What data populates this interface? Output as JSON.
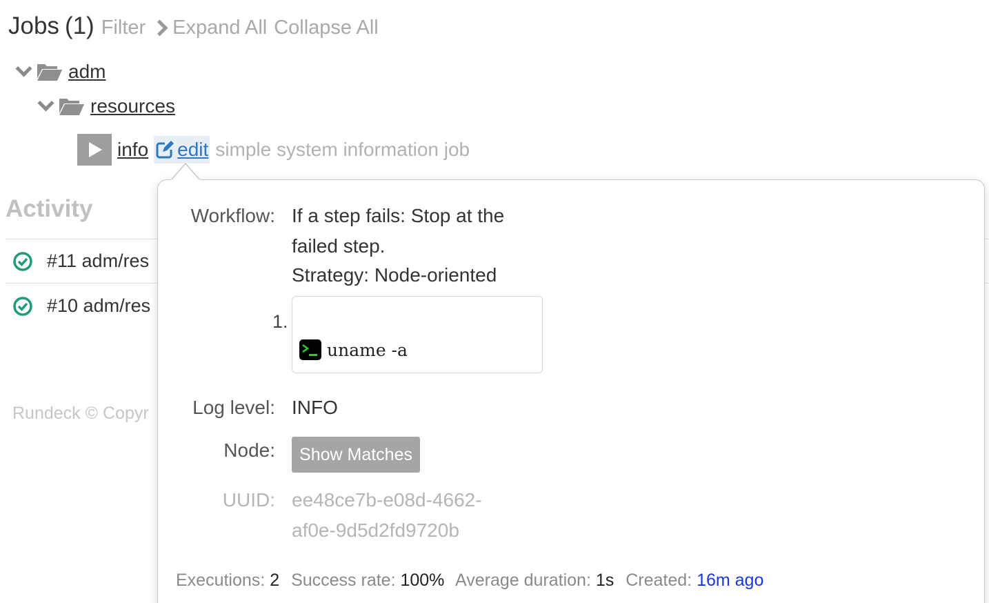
{
  "header": {
    "title": "Jobs",
    "count": "(1)",
    "filter_label": "Filter",
    "expand_label": "Expand All",
    "collapse_label": "Collapse All"
  },
  "tree": {
    "group": "adm",
    "subgroup": "resources",
    "job": {
      "name": "info",
      "edit_label": "edit",
      "description": "simple system information job"
    }
  },
  "activity": {
    "title": "Activity",
    "rows": [
      {
        "text": "#11 adm/res"
      },
      {
        "text": "#10 adm/res"
      }
    ],
    "footer": "Rundeck © Copyr"
  },
  "popover": {
    "workflow_label": "Workflow:",
    "workflow_line1": "If a step fails: Stop at the",
    "workflow_line2": "failed step.",
    "strategy": "Strategy: Node-oriented",
    "step_number": "1.",
    "step_command": "uname -a",
    "loglevel_label": "Log level:",
    "loglevel_value": "INFO",
    "node_label": "Node:",
    "show_matches_label": "Show Matches",
    "uuid_label": "UUID:",
    "uuid_line1": "ee48ce7b-e08d-4662-",
    "uuid_line2": "af0e-9d5d2fd9720b",
    "stats": {
      "executions_label": "Executions:",
      "executions_value": "2",
      "success_label": "Success rate:",
      "success_value": "100%",
      "duration_label": "Average duration:",
      "duration_value": "1s",
      "created_label": "Created:",
      "created_value": "16m ago"
    }
  },
  "colors": {
    "link_blue": "#2b78c5",
    "success_green": "#1f9a7a",
    "created_link": "#1a35e3"
  },
  "icons": [
    "chevron-right-icon",
    "chevron-down-icon",
    "folder-open-icon",
    "play-icon",
    "edit-icon",
    "check-circle-icon",
    "terminal-icon"
  ]
}
